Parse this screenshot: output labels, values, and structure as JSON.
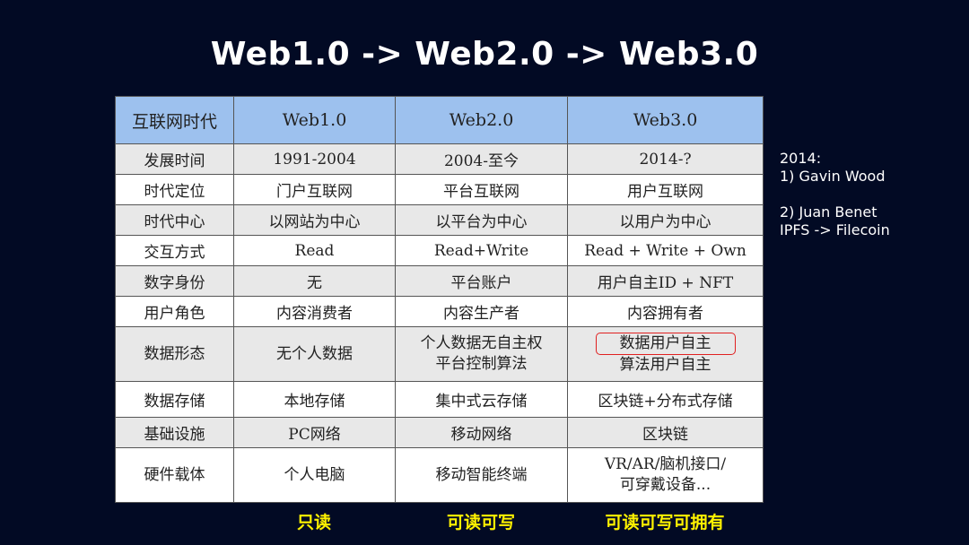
{
  "title": "Web1.0 -> Web2.0 -> Web3.0",
  "table": {
    "headers": [
      "互联网时代",
      "Web1.0",
      "Web2.0",
      "Web3.0"
    ],
    "rows": [
      [
        "发展时间",
        "1991-2004",
        "2004-至今",
        "2014-?"
      ],
      [
        "时代定位",
        "门户互联网",
        "平台互联网",
        "用户互联网"
      ],
      [
        "时代中心",
        "以网站为中心",
        "以平台为中心",
        "以用户为中心"
      ],
      [
        "交互方式",
        "Read",
        "Read+Write",
        "Read + Write + Own"
      ],
      [
        "数字身份",
        "无",
        "平台账户",
        "用户自主ID + NFT"
      ],
      [
        "用户角色",
        "内容消费者",
        "内容生产者",
        "内容拥有者"
      ],
      [
        "数据形态",
        "无个人数据",
        "个人数据无自主权",
        "数据用户自主"
      ],
      [
        "数据存储",
        "本地存储",
        "集中式云存储",
        "区块链+分布式存储"
      ],
      [
        "基础设施",
        "PC网络",
        "移动网络",
        "区块链"
      ],
      [
        "硬件载体",
        "个人电脑",
        "移动智能终端",
        "VR/AR/脑机接口/"
      ]
    ],
    "row_data_form_line2": [
      "",
      "",
      "平台控制算法",
      "算法用户自主"
    ],
    "row_hardware_line2": [
      "",
      "",
      "",
      "可穿戴设备..."
    ],
    "highlight_color": "#e02020"
  },
  "side_note": {
    "line1": "2014:",
    "line2": "1) Gavin Wood",
    "line3": "2) Juan Benet",
    "line4": "IPFS -> Filecoin"
  },
  "modes": [
    "只读",
    "可读可写",
    "可读可写可拥有"
  ],
  "colors": {
    "background": "#020a24",
    "header_bg": "#9dc1ee",
    "mode_text": "#fff200"
  }
}
